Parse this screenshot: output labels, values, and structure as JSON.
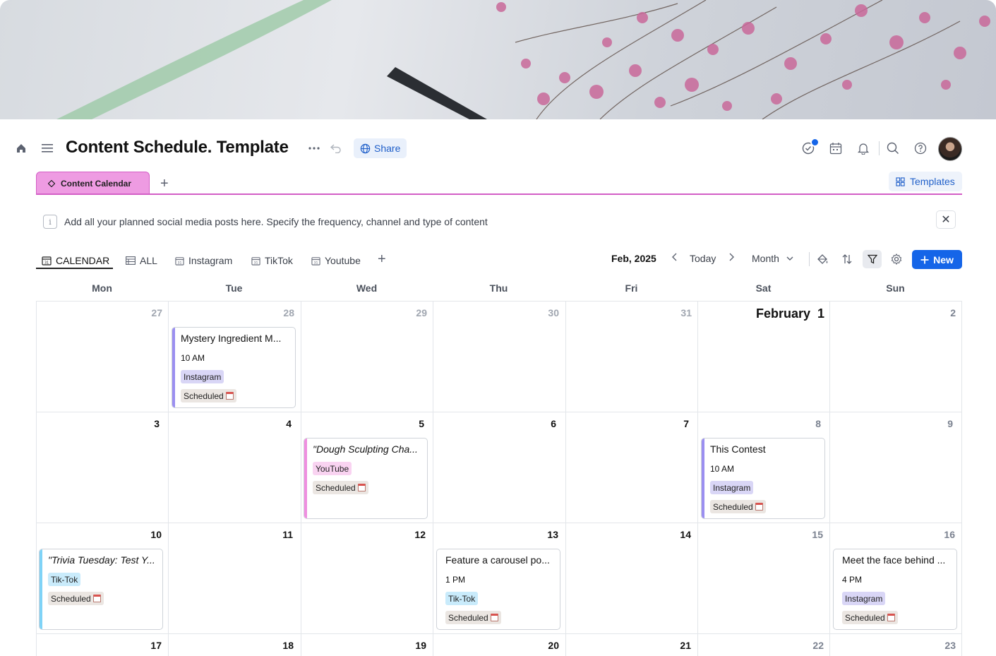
{
  "header": {
    "title": "Content Schedule. Template",
    "share_label": "Share",
    "templates_label": "Templates"
  },
  "views": {
    "active_view": "Content Calendar",
    "add_view": "+"
  },
  "info": {
    "text": "Add all your planned social media posts here. Specify the frequency, channel and type of content",
    "info_glyph": "i",
    "close_glyph": "✕"
  },
  "subtabs": [
    {
      "label": "CALENDAR",
      "icon": "calendar-icon"
    },
    {
      "label": "ALL",
      "icon": "table-icon"
    },
    {
      "label": "Instagram",
      "icon": "calendar-icon"
    },
    {
      "label": "TikTok",
      "icon": "calendar-icon"
    },
    {
      "label": "Youtube",
      "icon": "calendar-icon"
    }
  ],
  "controls": {
    "period": "Feb, 2025",
    "today": "Today",
    "mode": "Month",
    "new_label": "New"
  },
  "weekdays": [
    "Mon",
    "Tue",
    "Wed",
    "Thu",
    "Fri",
    "Sat",
    "Sun"
  ],
  "weeks": [
    [
      "27",
      "28",
      "29",
      "30",
      "31",
      "February  1",
      "2"
    ],
    [
      "3",
      "4",
      "5",
      "6",
      "7",
      "8",
      "9"
    ],
    [
      "10",
      "11",
      "12",
      "13",
      "14",
      "15",
      "16"
    ],
    [
      "17",
      "18",
      "19",
      "20",
      "21",
      "22",
      "23"
    ]
  ],
  "events": [
    {
      "title": "Mystery Ingredient M...",
      "time": "10 AM",
      "channel": "Instagram",
      "status": "Scheduled"
    },
    {
      "title": "\"Dough Sculpting Cha...",
      "time": "",
      "channel": "YouTube",
      "status": "Scheduled"
    },
    {
      "title": "This Contest",
      "time": "10 AM",
      "channel": "Instagram",
      "status": "Scheduled"
    },
    {
      "title": "\"Trivia Tuesday: Test Y...",
      "time": "",
      "channel": "Tik-Tok",
      "status": "Scheduled"
    },
    {
      "title": "Feature a carousel po...",
      "time": "1 PM",
      "channel": "Tik-Tok",
      "status": "Scheduled"
    },
    {
      "title": "Meet the face behind ...",
      "time": "4 PM",
      "channel": "Instagram",
      "status": "Scheduled"
    }
  ],
  "colors": {
    "accent": "#1565e8",
    "view_tab": "#ee9be2",
    "instagram_stripe": "#9b8ff0",
    "youtube_stripe": "#ef8fe0",
    "tiktok_stripe": "#7fd3f7"
  }
}
